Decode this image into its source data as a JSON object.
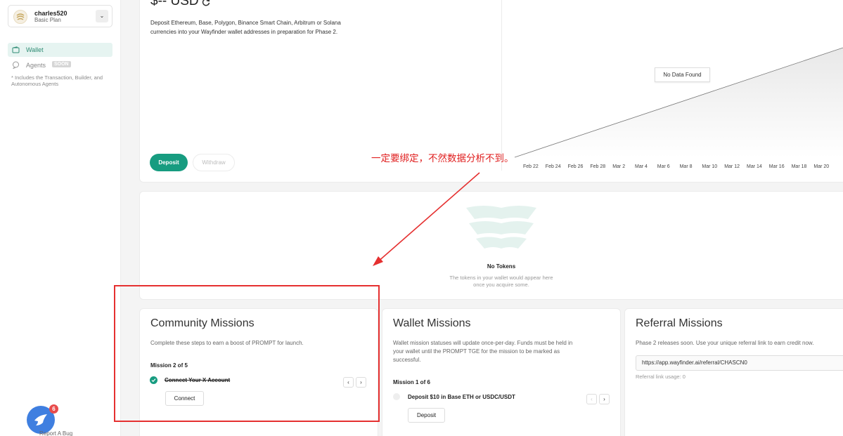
{
  "user": {
    "name": "charles520",
    "plan": "Basic Plan"
  },
  "nav": {
    "wallet_label": "Wallet",
    "agents_label": "Agents",
    "agents_badge": "SOON",
    "agents_note": "* Includes the Transaction, Builder, and Autonomous Agents"
  },
  "report_bug": "Report A Bug",
  "notification_count": "6",
  "wallet": {
    "balance": "$-- USD",
    "description": "Deposit Ethereum, Base, Polygon, Binance Smart Chain, Arbitrum or Solana currencies into your Wayfinder wallet addresses in preparation for Phase 2.",
    "deposit_label": "Deposit",
    "withdraw_label": "Withdraw"
  },
  "chart": {
    "no_data": "No Data Found",
    "x_ticks": [
      "Feb 22",
      "Feb 24",
      "Feb 26",
      "Feb 28",
      "Mar 2",
      "Mar 4",
      "Mar 6",
      "Mar 8",
      "Mar 10",
      "Mar 12",
      "Mar 14",
      "Mar 16",
      "Mar 18",
      "Mar 20"
    ]
  },
  "tokens": {
    "title": "No Tokens",
    "description": "The tokens in your wallet would appear here once you acquire some."
  },
  "annotation": "一定要绑定，不然数据分析不到。",
  "community": {
    "title": "Community Missions",
    "description": "Complete these steps to earn a boost of PROMPT for launch.",
    "mission_count": "Mission 2 of 5",
    "mission_item": "Connect Your X Account",
    "action_label": "Connect"
  },
  "wallet_missions": {
    "title": "Wallet Missions",
    "description": "Wallet mission statuses will update once-per-day. Funds must be held in your wallet until the PROMPT TGE for the mission to be marked as successful.",
    "mission_count": "Mission 1 of 6",
    "mission_item": "Deposit $10 in Base ETH or USDC/USDT",
    "action_label": "Deposit"
  },
  "referral": {
    "title": "Referral Missions",
    "description": "Phase 2 releases soon. Use your unique referral link to earn credit now.",
    "link": "https://app.wayfinder.ai/referral/CHASCN0",
    "usage": "Referral link usage: 0"
  },
  "colors": {
    "accent": "#179c80",
    "annotation": "#e02020"
  }
}
